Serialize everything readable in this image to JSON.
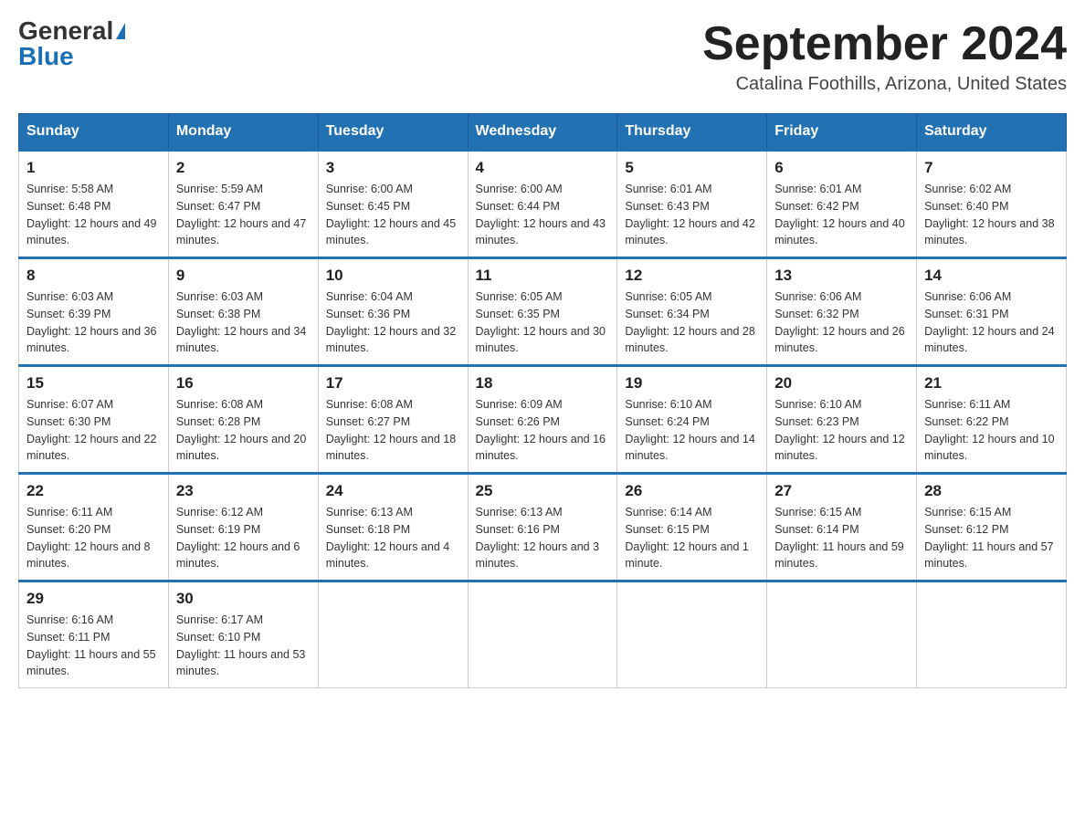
{
  "header": {
    "logo_general": "General",
    "logo_blue": "Blue",
    "month_title": "September 2024",
    "location": "Catalina Foothills, Arizona, United States"
  },
  "weekdays": [
    "Sunday",
    "Monday",
    "Tuesday",
    "Wednesday",
    "Thursday",
    "Friday",
    "Saturday"
  ],
  "weeks": [
    [
      {
        "day": "1",
        "sunrise": "5:58 AM",
        "sunset": "6:48 PM",
        "daylight": "12 hours and 49 minutes."
      },
      {
        "day": "2",
        "sunrise": "5:59 AM",
        "sunset": "6:47 PM",
        "daylight": "12 hours and 47 minutes."
      },
      {
        "day": "3",
        "sunrise": "6:00 AM",
        "sunset": "6:45 PM",
        "daylight": "12 hours and 45 minutes."
      },
      {
        "day": "4",
        "sunrise": "6:00 AM",
        "sunset": "6:44 PM",
        "daylight": "12 hours and 43 minutes."
      },
      {
        "day": "5",
        "sunrise": "6:01 AM",
        "sunset": "6:43 PM",
        "daylight": "12 hours and 42 minutes."
      },
      {
        "day": "6",
        "sunrise": "6:01 AM",
        "sunset": "6:42 PM",
        "daylight": "12 hours and 40 minutes."
      },
      {
        "day": "7",
        "sunrise": "6:02 AM",
        "sunset": "6:40 PM",
        "daylight": "12 hours and 38 minutes."
      }
    ],
    [
      {
        "day": "8",
        "sunrise": "6:03 AM",
        "sunset": "6:39 PM",
        "daylight": "12 hours and 36 minutes."
      },
      {
        "day": "9",
        "sunrise": "6:03 AM",
        "sunset": "6:38 PM",
        "daylight": "12 hours and 34 minutes."
      },
      {
        "day": "10",
        "sunrise": "6:04 AM",
        "sunset": "6:36 PM",
        "daylight": "12 hours and 32 minutes."
      },
      {
        "day": "11",
        "sunrise": "6:05 AM",
        "sunset": "6:35 PM",
        "daylight": "12 hours and 30 minutes."
      },
      {
        "day": "12",
        "sunrise": "6:05 AM",
        "sunset": "6:34 PM",
        "daylight": "12 hours and 28 minutes."
      },
      {
        "day": "13",
        "sunrise": "6:06 AM",
        "sunset": "6:32 PM",
        "daylight": "12 hours and 26 minutes."
      },
      {
        "day": "14",
        "sunrise": "6:06 AM",
        "sunset": "6:31 PM",
        "daylight": "12 hours and 24 minutes."
      }
    ],
    [
      {
        "day": "15",
        "sunrise": "6:07 AM",
        "sunset": "6:30 PM",
        "daylight": "12 hours and 22 minutes."
      },
      {
        "day": "16",
        "sunrise": "6:08 AM",
        "sunset": "6:28 PM",
        "daylight": "12 hours and 20 minutes."
      },
      {
        "day": "17",
        "sunrise": "6:08 AM",
        "sunset": "6:27 PM",
        "daylight": "12 hours and 18 minutes."
      },
      {
        "day": "18",
        "sunrise": "6:09 AM",
        "sunset": "6:26 PM",
        "daylight": "12 hours and 16 minutes."
      },
      {
        "day": "19",
        "sunrise": "6:10 AM",
        "sunset": "6:24 PM",
        "daylight": "12 hours and 14 minutes."
      },
      {
        "day": "20",
        "sunrise": "6:10 AM",
        "sunset": "6:23 PM",
        "daylight": "12 hours and 12 minutes."
      },
      {
        "day": "21",
        "sunrise": "6:11 AM",
        "sunset": "6:22 PM",
        "daylight": "12 hours and 10 minutes."
      }
    ],
    [
      {
        "day": "22",
        "sunrise": "6:11 AM",
        "sunset": "6:20 PM",
        "daylight": "12 hours and 8 minutes."
      },
      {
        "day": "23",
        "sunrise": "6:12 AM",
        "sunset": "6:19 PM",
        "daylight": "12 hours and 6 minutes."
      },
      {
        "day": "24",
        "sunrise": "6:13 AM",
        "sunset": "6:18 PM",
        "daylight": "12 hours and 4 minutes."
      },
      {
        "day": "25",
        "sunrise": "6:13 AM",
        "sunset": "6:16 PM",
        "daylight": "12 hours and 3 minutes."
      },
      {
        "day": "26",
        "sunrise": "6:14 AM",
        "sunset": "6:15 PM",
        "daylight": "12 hours and 1 minute."
      },
      {
        "day": "27",
        "sunrise": "6:15 AM",
        "sunset": "6:14 PM",
        "daylight": "11 hours and 59 minutes."
      },
      {
        "day": "28",
        "sunrise": "6:15 AM",
        "sunset": "6:12 PM",
        "daylight": "11 hours and 57 minutes."
      }
    ],
    [
      {
        "day": "29",
        "sunrise": "6:16 AM",
        "sunset": "6:11 PM",
        "daylight": "11 hours and 55 minutes."
      },
      {
        "day": "30",
        "sunrise": "6:17 AM",
        "sunset": "6:10 PM",
        "daylight": "11 hours and 53 minutes."
      },
      null,
      null,
      null,
      null,
      null
    ]
  ]
}
